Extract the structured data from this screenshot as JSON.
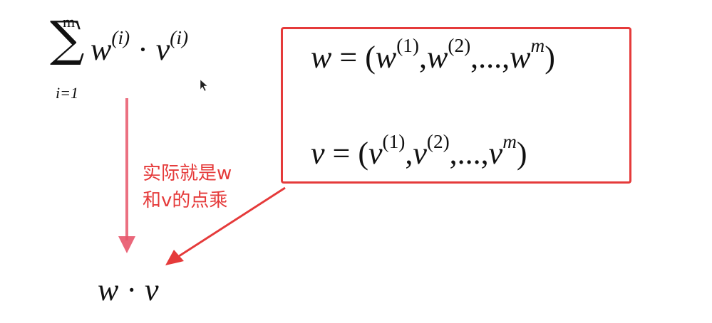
{
  "sum_expression": {
    "upper_limit": "m",
    "lower_limit": "i=1",
    "sigma": "∑",
    "term_w": "w",
    "sup_i_1": "(i)",
    "dot": "·",
    "term_v": "v",
    "sup_i_2": "(i)"
  },
  "definitions": {
    "w_line": {
      "lhs": "w",
      "eq": "=",
      "open": "(",
      "w1": "w",
      "s1": "(1)",
      "comma1": ",",
      "w2": "w",
      "s2": "(2)",
      "ellipsis": ",...,",
      "wm": "w",
      "sm": "m",
      "close": ")"
    },
    "v_line": {
      "lhs": "v",
      "eq": "=",
      "open": "(",
      "v1": "v",
      "s1": "(1)",
      "comma1": ",",
      "v2": "v",
      "s2": "(2)",
      "ellipsis": ",...,",
      "vm": "v",
      "sm": "m",
      "close": ")"
    }
  },
  "annotation": {
    "line1": "实际就是w",
    "line2": "和v的点乘"
  },
  "result": {
    "w": "w",
    "dot": "·",
    "v": "v"
  },
  "colors": {
    "highlight_red": "#e53a3a",
    "text": "#111111",
    "down_arrow_pink": "#e8576b"
  }
}
